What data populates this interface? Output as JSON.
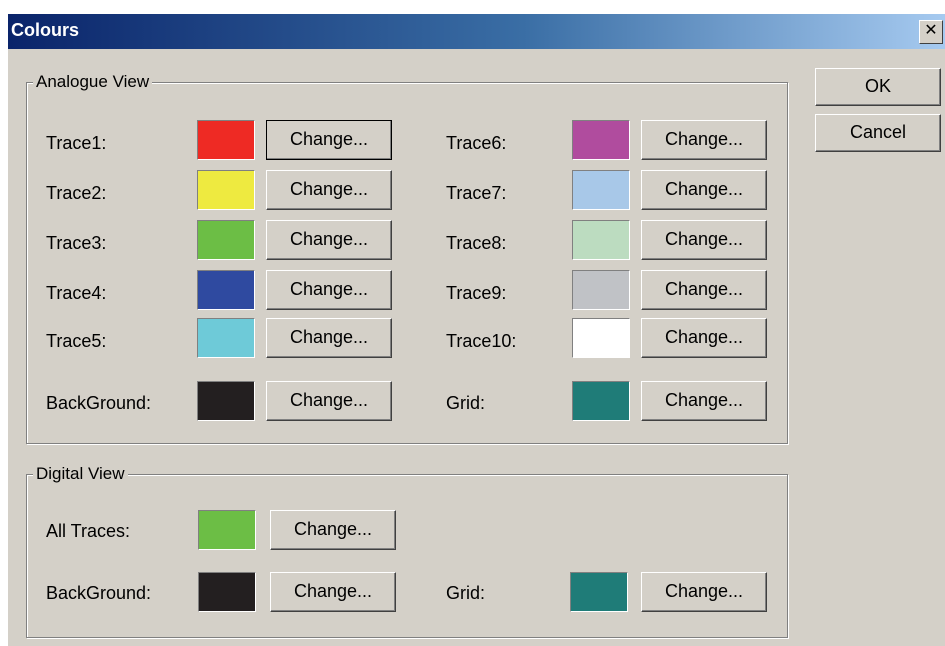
{
  "dialog": {
    "title": "Colours",
    "close_glyph": "✕",
    "ok_label": "OK",
    "cancel_label": "Cancel"
  },
  "analogue": {
    "legend": "Analogue View",
    "change_label": "Change...",
    "rows": [
      {
        "label": "Trace1:",
        "color": "#ee2a24"
      },
      {
        "label": "Trace2:",
        "color": "#eeea40"
      },
      {
        "label": "Trace3:",
        "color": "#6cbe45"
      },
      {
        "label": "Trace4:",
        "color": "#2f4aa0"
      },
      {
        "label": "Trace5:",
        "color": "#6ecad8"
      },
      {
        "label": "Trace6:",
        "color": "#b04c9e"
      },
      {
        "label": "Trace7:",
        "color": "#a8c8e8"
      },
      {
        "label": "Trace8:",
        "color": "#bcdcc0"
      },
      {
        "label": "Trace9:",
        "color": "#c0c2c6"
      },
      {
        "label": "Trace10:",
        "color": "#ffffff"
      },
      {
        "label": "BackGround:",
        "color": "#231f20"
      },
      {
        "label": "Grid:",
        "color": "#1f7c78"
      }
    ]
  },
  "digital": {
    "legend": "Digital View",
    "change_label": "Change...",
    "rows": [
      {
        "label": "All Traces:",
        "color": "#6cbe45"
      },
      {
        "label": "BackGround:",
        "color": "#231f20"
      },
      {
        "label": "Grid:",
        "color": "#1f7c78"
      }
    ]
  }
}
